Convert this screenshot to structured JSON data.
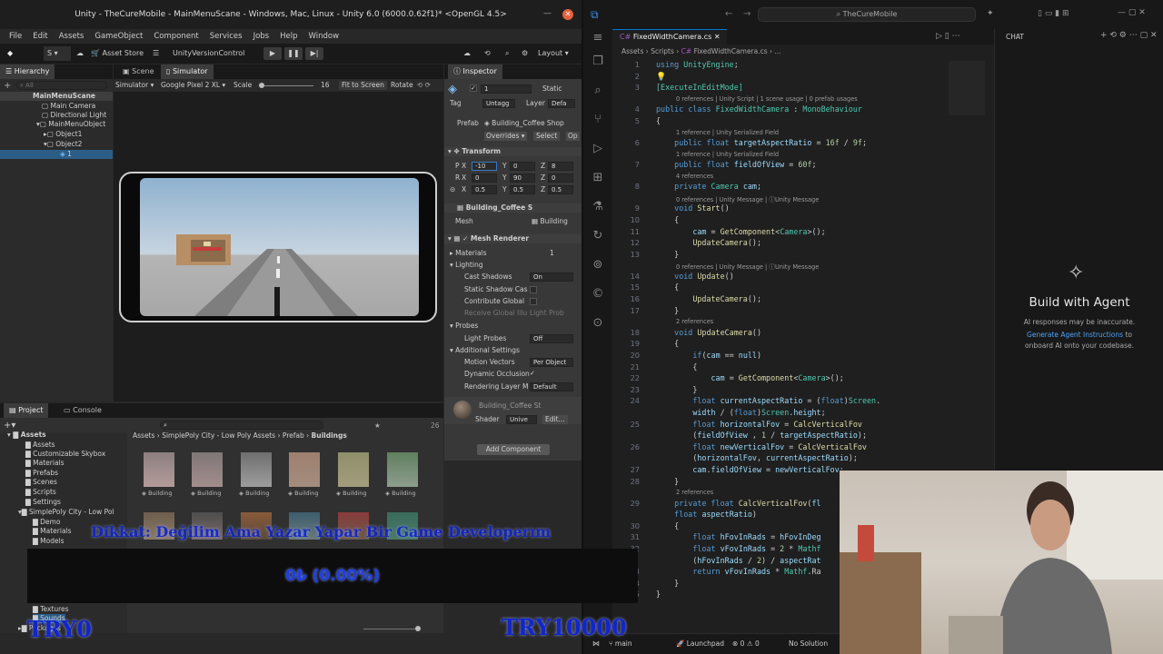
{
  "unity": {
    "title": "Unity - TheCureMobile - MainMenuScane - Windows, Mac, Linux - Unity 6.0 (6000.0.62f1)* <OpenGL 4.5>",
    "menu": [
      "File",
      "Edit",
      "Assets",
      "GameObject",
      "Component",
      "Services",
      "Jobs",
      "Help",
      "Window"
    ],
    "toolbar": {
      "account": "S",
      "asset_store": "Asset Store",
      "version_control": "UnityVersionControl",
      "layout": "Layout"
    },
    "hierarchy": {
      "tab": "Hierarchy",
      "search_placeholder": "All",
      "items": [
        "MainMenuScane",
        "Main Camera",
        "Directional Light",
        "MainMenuObject",
        "Object1",
        "Object2",
        "1"
      ]
    },
    "scene_tabs": {
      "scene": "Scene",
      "simulator": "Simulator"
    },
    "simulator_bar": {
      "mode": "Simulator",
      "device": "Google Pixel 2 XL",
      "scale_label": "Scale",
      "scale_value": "16",
      "fit": "Fit to Screen",
      "rotate": "Rotate"
    },
    "inspector": {
      "tab": "Inspector",
      "object_name": "1",
      "static_label": "Static",
      "tag_label": "Tag",
      "tag_value": "Untagg",
      "layer_label": "Layer",
      "layer_value": "Defa",
      "prefab_label": "Prefab",
      "prefab_value": "Building_Coffee Shop",
      "overrides": "Overrides",
      "select": "Select",
      "open": "Op",
      "transform": "Transform",
      "pos": {
        "label": "P",
        "x": "-10",
        "y": "0",
        "z": "8"
      },
      "rot": {
        "label": "R",
        "x": "0",
        "y": "90",
        "z": "0"
      },
      "scale": {
        "x": "0.5",
        "y": "0.5",
        "z": "0.5"
      },
      "mesh_filter": "Building_Coffee S",
      "mesh_label": "Mesh",
      "mesh_value": "Building",
      "mesh_renderer": "Mesh Renderer",
      "materials": "Materials",
      "materials_count": "1",
      "lighting": "Lighting",
      "cast_shadows": "Cast Shadows",
      "cast_shadows_value": "On",
      "static_shadow": "Static Shadow Cas",
      "contribute_gi": "Contribute Global",
      "receive_gi": "Receive Global Illu",
      "receive_gi_value": "Light Prob",
      "probes": "Probes",
      "light_probes": "Light Probes",
      "light_probes_value": "Off",
      "additional": "Additional Settings",
      "motion_vectors": "Motion Vectors",
      "motion_vectors_value": "Per Object",
      "dynamic_occlusion": "Dynamic Occlusion",
      "rendering_layer": "Rendering Layer M",
      "rendering_layer_value": "Default",
      "material_name": "Building_Coffee St",
      "shader_label": "Shader",
      "shader_value": "Unive",
      "edit": "Edit...",
      "add_component": "Add Component"
    },
    "project": {
      "tabs": [
        "Project",
        "Console"
      ],
      "count": "26",
      "breadcrumb": [
        "Assets",
        "SimplePoly City - Low Poly Assets",
        "Prefab",
        "Buildings"
      ],
      "tree": [
        "Assets",
        "Assets",
        "Customizable Skybox",
        "Materials",
        "Prefabs",
        "Scenes",
        "Scripts",
        "Settings",
        "SimplePoly City - Low Pol",
        "Demo",
        "Materials",
        "Models",
        "Textures",
        "Sounds",
        "Packages"
      ],
      "thumb_label": "Building"
    }
  },
  "overlays": {
    "banner": "Dikkat: Değilim Ama Yazar Yapar Bir Game Developerım",
    "progress": "0₺ (0.00%)",
    "left_text": "TRY0",
    "right_text": "TRY10000"
  },
  "vscode": {
    "search": "TheCureMobile",
    "tab": "FixedWidthCamera.cs",
    "breadcrumb": [
      "Assets",
      "Scripts",
      "FixedWidthCamera.cs",
      "..."
    ],
    "chat": {
      "title": "CHAT",
      "heading": "Build with Agent",
      "note": "AI responses may be inaccurate.",
      "link": "Generate Agent Instructions",
      "note2": " to",
      "note3": "onboard AI onto your codebase."
    },
    "status": {
      "branch": "main",
      "launchpad": "Launchpad",
      "errors": "0",
      "warnings": "0",
      "solution": "No Solution"
    }
  },
  "code_lines": [
    {
      "n": "1",
      "t": "using UnityEngine;"
    },
    {
      "n": "2",
      "t": ""
    },
    {
      "n": "3",
      "t": "[ExecuteInEditMode]"
    },
    {
      "lens": "0 references | Unity Script | 1 scene usage | 0 prefab usages"
    },
    {
      "n": "4",
      "t": "public class FixedWidthCamera : MonoBehaviour"
    },
    {
      "n": "5",
      "t": "{"
    },
    {
      "lens": "1 reference | Unity Serialized Field"
    },
    {
      "n": "6",
      "t": "    public float targetAspectRatio = 16f / 9f;"
    },
    {
      "lens": "1 reference | Unity Serialized Field"
    },
    {
      "n": "7",
      "t": "    public float fieldOfView = 60f;"
    },
    {
      "lens": "4 references"
    },
    {
      "n": "8",
      "t": "    private Camera cam;"
    },
    {
      "lens": "0 references | Unity Message | ⓘUnity Message"
    },
    {
      "n": "9",
      "t": "    void Start()"
    },
    {
      "n": "10",
      "t": "    {"
    },
    {
      "n": "11",
      "t": "        cam = GetComponent<Camera>();"
    },
    {
      "n": "12",
      "t": "        UpdateCamera();"
    },
    {
      "n": "13",
      "t": "    }"
    },
    {
      "lens": "0 references | Unity Message | ⓘUnity Message"
    },
    {
      "n": "14",
      "t": "    void Update()"
    },
    {
      "n": "15",
      "t": "    {"
    },
    {
      "n": "16",
      "t": "        UpdateCamera();"
    },
    {
      "n": "17",
      "t": "    }"
    },
    {
      "lens": "2 references"
    },
    {
      "n": "18",
      "t": "    void UpdateCamera()"
    },
    {
      "n": "19",
      "t": "    {"
    },
    {
      "n": "20",
      "t": "        if(cam == null)"
    },
    {
      "n": "21",
      "t": "        {"
    },
    {
      "n": "22",
      "t": "            cam = GetComponent<Camera>();"
    },
    {
      "n": "23",
      "t": "        }"
    },
    {
      "n": "24",
      "t": "        float currentAspectRatio = (float)Screen."
    },
    {
      "n": "",
      "t": "        width / (float)Screen.height;"
    },
    {
      "n": "25",
      "t": "        float horizontalFov = CalcVerticalFov"
    },
    {
      "n": "",
      "t": "        (fieldOfView , 1 / targetAspectRatio);"
    },
    {
      "n": "26",
      "t": "        float newVerticalFov = CalcVerticalFov"
    },
    {
      "n": "",
      "t": "        (horizontalFov, currentAspectRatio);"
    },
    {
      "n": "27",
      "t": "        cam.fieldOfView = newVerticalFov;"
    },
    {
      "n": "28",
      "t": "    }"
    },
    {
      "lens": "2 references"
    },
    {
      "n": "29",
      "t": "    private float CalcVerticalFov(fl"
    },
    {
      "n": "",
      "t": "    float aspectRatio)"
    },
    {
      "n": "30",
      "t": "    {"
    },
    {
      "n": "31",
      "t": "        float hFovInRads = hFovInDeg"
    },
    {
      "n": "32",
      "t": "        float vFovInRads = 2 * Mathf"
    },
    {
      "n": "",
      "t": "        (hFovInRads / 2) / aspectRat"
    },
    {
      "n": "33",
      "t": "        return vFovInRads * Mathf.Ra"
    },
    {
      "n": "34",
      "t": "    }"
    },
    {
      "n": "35",
      "t": "}"
    }
  ]
}
